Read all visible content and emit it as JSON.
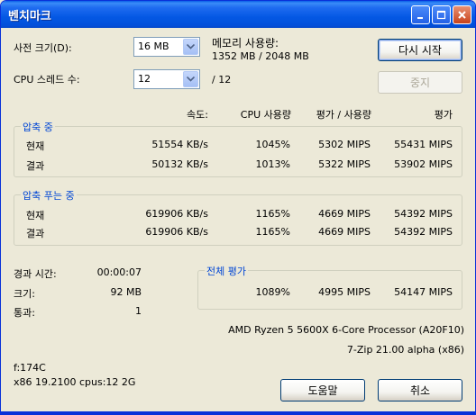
{
  "window": {
    "title": "벤치마크"
  },
  "controls": {
    "dict_size_label": "사전 크기(D):",
    "dict_size_value": "16 MB",
    "threads_label": "CPU 스레드 수:",
    "threads_value": "12",
    "threads_max": "/ 12",
    "memory_label": "메모리 사용량:",
    "memory_value": "1352 MB / 2048 MB",
    "restart_button": "다시 시작",
    "stop_button": "중지"
  },
  "columns": {
    "speed": "속도:",
    "cpu_usage": "CPU 사용량",
    "rating_per_usage": "평가 / 사용량",
    "rating": "평가"
  },
  "compress": {
    "title": "압축 중",
    "rows": [
      {
        "label": "현재",
        "speed": "51554 KB/s",
        "cpu": "1045%",
        "rpu": "5302 MIPS",
        "rating": "55431 MIPS"
      },
      {
        "label": "결과",
        "speed": "50132 KB/s",
        "cpu": "1013%",
        "rpu": "5322 MIPS",
        "rating": "53902 MIPS"
      }
    ]
  },
  "decompress": {
    "title": "압축 푸는 중",
    "rows": [
      {
        "label": "현재",
        "speed": "619906 KB/s",
        "cpu": "1165%",
        "rpu": "4669 MIPS",
        "rating": "54392 MIPS"
      },
      {
        "label": "결과",
        "speed": "619906 KB/s",
        "cpu": "1165%",
        "rpu": "4669 MIPS",
        "rating": "54392 MIPS"
      }
    ]
  },
  "stats": {
    "elapsed_label": "경과 시간:",
    "elapsed_value": "00:00:07",
    "size_label": "크기:",
    "size_value": "92 MB",
    "passes_label": "통과:",
    "passes_value": "1"
  },
  "total": {
    "title": "전체 평가",
    "cpu": "1089%",
    "rpu": "4995 MIPS",
    "rating": "54147 MIPS"
  },
  "system": {
    "cpu_name": "AMD Ryzen 5 5600X 6-Core Processor (A20F10)",
    "version": "7-Zip 21.00 alpha (x86)",
    "flags": "f:174C",
    "arch": "x86 19.2100 cpus:12 2G"
  },
  "footer": {
    "help_button": "도움말",
    "cancel_button": "취소"
  }
}
